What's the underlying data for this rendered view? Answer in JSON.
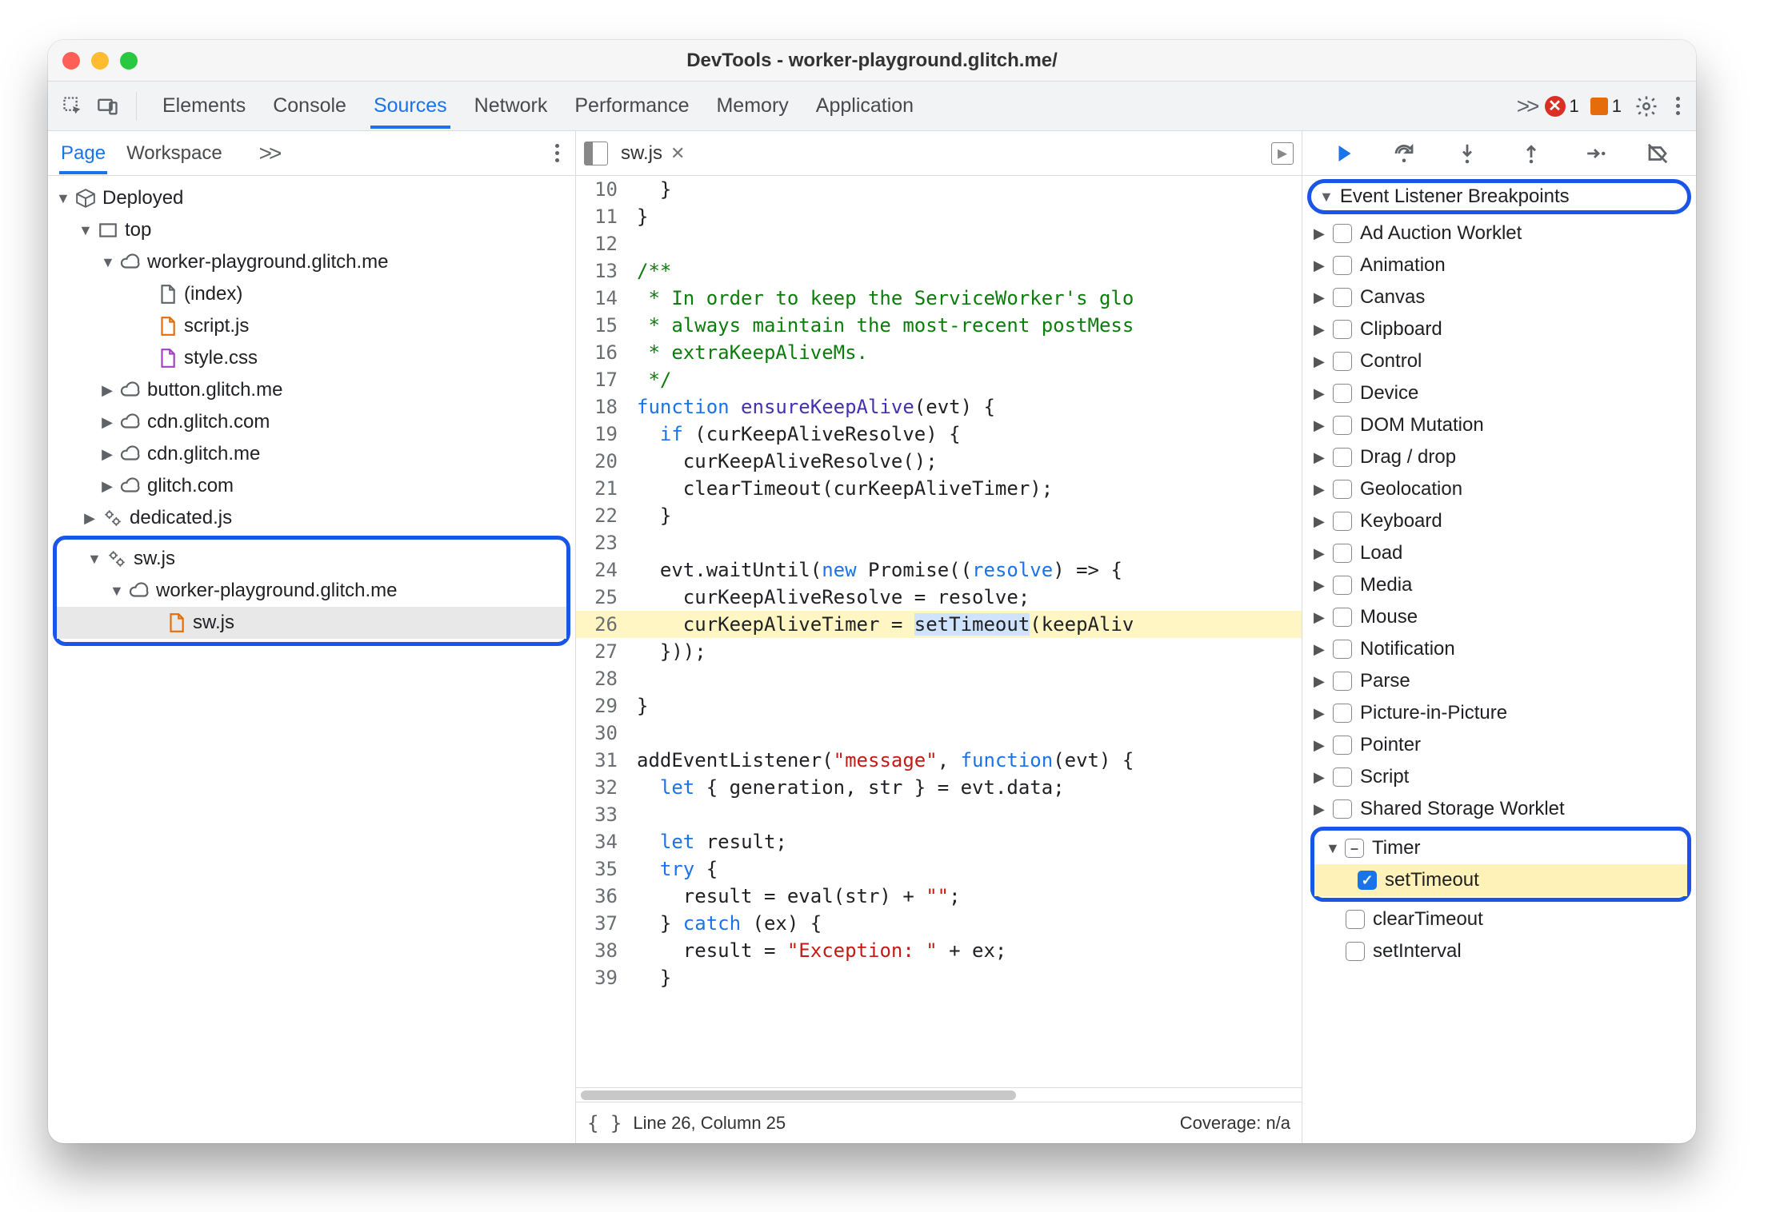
{
  "window": {
    "title": "DevTools - worker-playground.glitch.me/"
  },
  "tabs": {
    "items": [
      "Elements",
      "Console",
      "Sources",
      "Network",
      "Performance",
      "Memory",
      "Application"
    ],
    "active": "Sources",
    "overflow": ">>",
    "errors_count": "1",
    "warnings_count": "1"
  },
  "navigator": {
    "subtabs": {
      "items": [
        "Page",
        "Workspace"
      ],
      "active": "Page",
      "overflow": ">>"
    },
    "tree": {
      "root": "Deployed",
      "top": "top",
      "origin1": "worker-playground.glitch.me",
      "files1": [
        "(index)",
        "script.js",
        "style.css"
      ],
      "folded": [
        "button.glitch.me",
        "cdn.glitch.com",
        "cdn.glitch.me",
        "glitch.com"
      ],
      "dedicated": "dedicated.js",
      "sw_root": "sw.js",
      "sw_origin": "worker-playground.glitch.me",
      "sw_file": "sw.js"
    }
  },
  "editor": {
    "filename": "sw.js",
    "lines": [
      {
        "n": 10,
        "raw": "  }"
      },
      {
        "n": 11,
        "raw": "}"
      },
      {
        "n": 12,
        "raw": ""
      },
      {
        "n": 13,
        "raw": "/**",
        "comment": true
      },
      {
        "n": 14,
        "raw": " * In order to keep the ServiceWorker's glo",
        "comment": true
      },
      {
        "n": 15,
        "raw": " * always maintain the most-recent postMess",
        "comment": true
      },
      {
        "n": 16,
        "raw": " * extraKeepAliveMs.",
        "comment": true
      },
      {
        "n": 17,
        "raw": " */",
        "comment": true
      },
      {
        "n": 18,
        "kw": "function",
        "fn": " ensureKeepAlive",
        "rest": "(evt) {"
      },
      {
        "n": 19,
        "raw": "  if (curKeepAliveResolve) {",
        "if": true
      },
      {
        "n": 20,
        "raw": "    curKeepAliveResolve();"
      },
      {
        "n": 21,
        "raw": "    clearTimeout(curKeepAliveTimer);"
      },
      {
        "n": 22,
        "raw": "  }"
      },
      {
        "n": 23,
        "raw": ""
      },
      {
        "n": 24,
        "raw": "  evt.waitUntil(new Promise((resolve) => {",
        "p24": true
      },
      {
        "n": 25,
        "raw": "    curKeepAliveResolve = resolve;"
      },
      {
        "n": 26,
        "hl": true,
        "pre": "    curKeepAliveTimer = ",
        "sel": "setTimeout",
        "post": "(keepAliv"
      },
      {
        "n": 27,
        "raw": "  }));"
      },
      {
        "n": 28,
        "raw": ""
      },
      {
        "n": 29,
        "raw": "}"
      },
      {
        "n": 30,
        "raw": ""
      },
      {
        "n": 31,
        "raw": "addEventListener(\"message\", function(evt) {",
        "p31": true
      },
      {
        "n": 32,
        "raw": "  let { generation, str } = evt.data;",
        "let": true
      },
      {
        "n": 33,
        "raw": ""
      },
      {
        "n": 34,
        "raw": "  let result;",
        "let": true
      },
      {
        "n": 35,
        "raw": "  try {",
        "try": true
      },
      {
        "n": 36,
        "raw": "    result = eval(str) + \"\";",
        "p36": true
      },
      {
        "n": 37,
        "raw": "  } catch (ex) {",
        "catch": true
      },
      {
        "n": 38,
        "raw": "    result = \"Exception: \" + ex;",
        "p38": true
      },
      {
        "n": 39,
        "raw": "  }"
      }
    ],
    "status": {
      "cursor": "Line 26, Column 25",
      "coverage": "Coverage: n/a"
    }
  },
  "debugger": {
    "section_title": "Event Listener Breakpoints",
    "categories": [
      "Ad Auction Worklet",
      "Animation",
      "Canvas",
      "Clipboard",
      "Control",
      "Device",
      "DOM Mutation",
      "Drag / drop",
      "Geolocation",
      "Keyboard",
      "Load",
      "Media",
      "Mouse",
      "Notification",
      "Parse",
      "Picture-in-Picture",
      "Pointer",
      "Script",
      "Shared Storage Worklet"
    ],
    "timer": {
      "label": "Timer",
      "items": [
        "setTimeout",
        "clearTimeout",
        "setInterval"
      ],
      "checked": "setTimeout"
    }
  }
}
